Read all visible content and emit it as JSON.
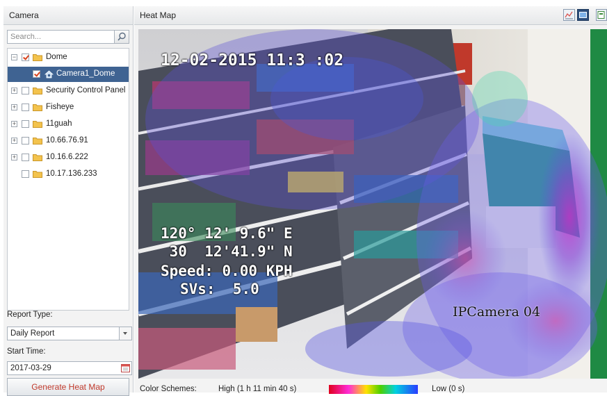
{
  "left_panel": {
    "header": "Camera",
    "search_placeholder": "Search...",
    "tree": [
      {
        "label": "Dome",
        "checked": true,
        "expanded": true,
        "type": "folder"
      },
      {
        "label": "Camera1_Dome",
        "checked": true,
        "type": "camera",
        "selected": true
      },
      {
        "label": "Security Control Panel",
        "checked": false,
        "type": "folder"
      },
      {
        "label": "Fisheye",
        "checked": false,
        "type": "folder"
      },
      {
        "label": "11guah",
        "checked": false,
        "type": "folder"
      },
      {
        "label": "10.66.76.91",
        "checked": false,
        "type": "folder"
      },
      {
        "label": "10.16.6.222",
        "checked": false,
        "type": "folder"
      },
      {
        "label": "10.17.136.233",
        "checked": false,
        "type": "folder"
      }
    ],
    "report_type_label": "Report Type:",
    "report_type_value": "Daily Report",
    "start_time_label": "Start Time:",
    "start_time_value": "2017-03-29",
    "generate_button": "Generate Heat Map"
  },
  "right_panel": {
    "header": "Heat Map",
    "video": {
      "timestamp": "12-02-2015 11:3 :02",
      "coord_line1": "120° 12' 9.6\" E",
      "coord_line2": " 30  12'41.9\" N",
      "speed": "Speed: 0.00 KPH",
      "svs": "SVs:  5.0",
      "camera_name": "IPCamera 04"
    },
    "legend": {
      "label": "Color Schemes:",
      "high": "High (1 h 11 min 40 s)",
      "low": "Low (0 s)"
    }
  },
  "colors": {
    "selected_row": "#3f6392",
    "generate_text": "#c0392b",
    "checkmark": "#d9421c"
  }
}
